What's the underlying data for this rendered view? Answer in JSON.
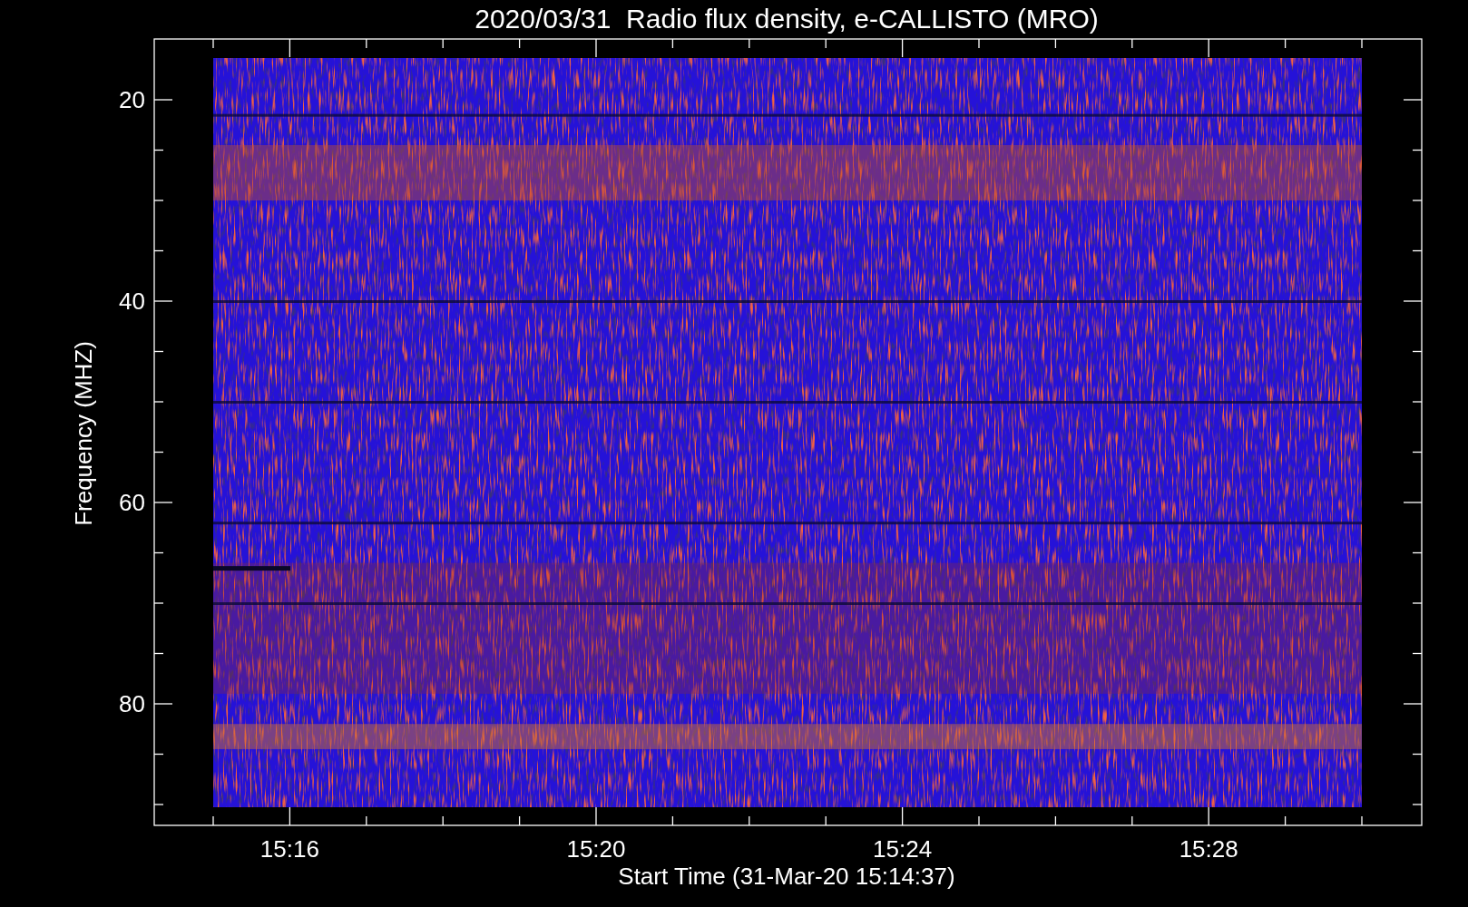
{
  "spectrogram": {
    "title": "2020/03/31  Radio flux density, e-CALLISTO (MRO)",
    "xlabel": "Start Time (31-Mar-20 15:14:37)",
    "ylabel": "Frequency (MHZ)",
    "xticks": [
      "15:16",
      "15:20",
      "15:24",
      "15:28"
    ],
    "yticks": [
      "20",
      "40",
      "60",
      "80"
    ]
  }
}
